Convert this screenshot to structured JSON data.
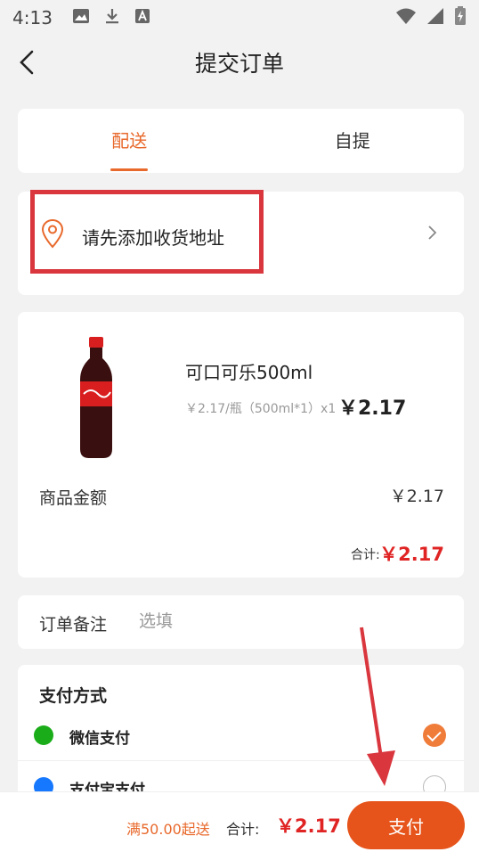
{
  "status_bar": {
    "time": "4:13"
  },
  "navbar": {
    "title": "提交订单"
  },
  "tabs": [
    {
      "label": "配送",
      "active": true
    },
    {
      "label": "自提",
      "active": false
    }
  ],
  "address": {
    "prompt": "请先添加收货地址"
  },
  "goods": {
    "name": "可口可乐500ml",
    "spec": "￥2.17/瓶（500ml*1）x1",
    "price": "￥2.17",
    "amount_label": "商品金额",
    "amount_value": "￥2.17",
    "total_label": "合计:",
    "total_value": "￥2.17"
  },
  "remark": {
    "label": "订单备注",
    "placeholder": "选填"
  },
  "payment": {
    "title": "支付方式",
    "options": [
      {
        "label": "微信支付",
        "selected": true,
        "icon": "wechat-pay-icon"
      },
      {
        "label": "支付宝支付",
        "selected": false,
        "icon": "alipay-icon"
      }
    ]
  },
  "bottom_bar": {
    "min_note": "满50.00起送",
    "total_label": "合计:",
    "total_value": "￥2.17",
    "pay_button": "支付"
  },
  "colors": {
    "accent": "#e8692c",
    "price_red": "#e02424",
    "highlight": "#d9363e",
    "pay_button": "#e6541b"
  }
}
